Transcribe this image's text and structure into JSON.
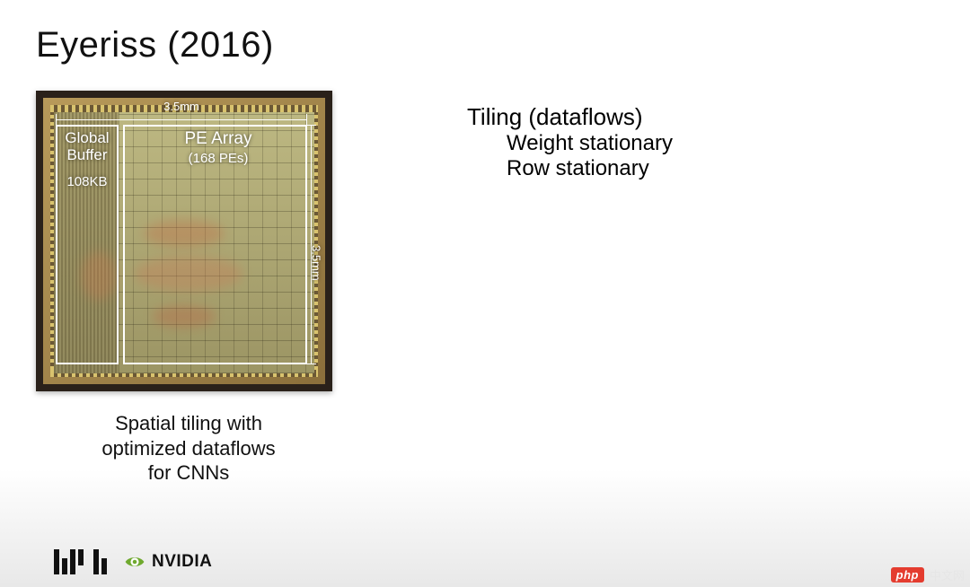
{
  "title": "Eyeriss (2016)",
  "chip": {
    "width_label": "3.5mm",
    "height_label": "3.5mm",
    "buffer_label_line1": "Global",
    "buffer_label_line2": "Buffer",
    "buffer_size": "108KB",
    "pe_array_label": "PE Array",
    "pe_count_label": "(168 PEs)"
  },
  "caption_line1": "Spatial tiling with",
  "caption_line2": "optimized dataflows",
  "caption_line3": "for CNNs",
  "bullets": {
    "head": "Tiling (dataflows)",
    "items": [
      "Weight stationary",
      "Row stationary"
    ]
  },
  "logos": {
    "mit_name": "mit-logo",
    "nvidia_text": "NVIDIA"
  },
  "watermark": {
    "badge": "php",
    "text": "中文网"
  }
}
